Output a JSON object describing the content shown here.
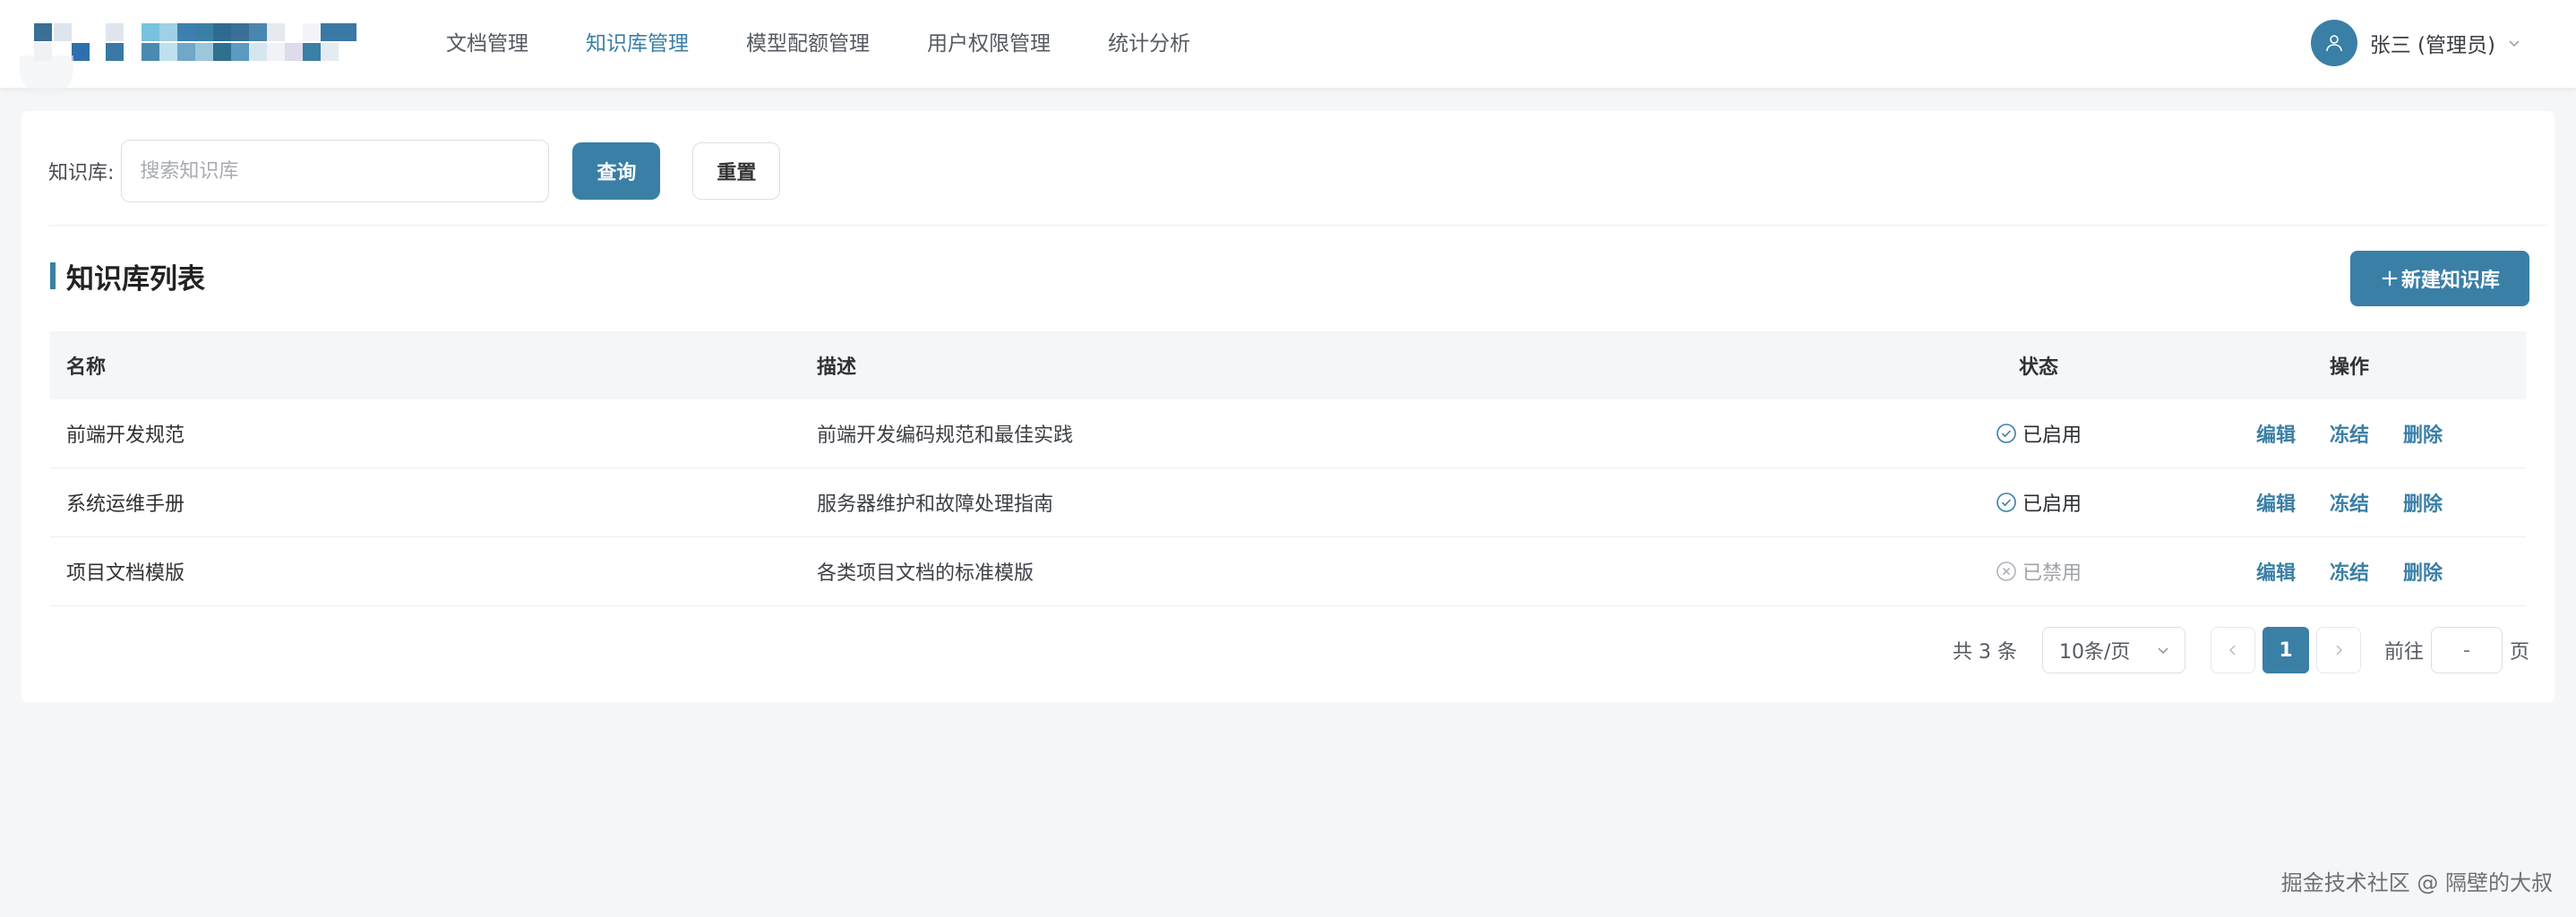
{
  "colors": {
    "accent": "#3a7fa6",
    "enabled_icon": "#3a7fa6",
    "disabled_icon": "#b0b3b8"
  },
  "nav": {
    "items": [
      {
        "label": "文档管理",
        "active": false
      },
      {
        "label": "知识库管理",
        "active": true
      },
      {
        "label": "模型配额管理",
        "active": false
      },
      {
        "label": "用户权限管理",
        "active": false
      },
      {
        "label": "统计分析",
        "active": false
      }
    ]
  },
  "user": {
    "name": "张三 (管理员)",
    "avatar_icon": "user-icon",
    "caret_icon": "chevron-down-icon"
  },
  "search": {
    "label": "知识库:",
    "placeholder": "搜索知识库",
    "value": "",
    "query_label": "查询",
    "reset_label": "重置"
  },
  "section": {
    "title": "知识库列表",
    "new_button_plus": "+",
    "new_button_label": "新建知识库"
  },
  "table": {
    "headers": {
      "name": "名称",
      "desc": "描述",
      "status": "状态",
      "ops": "操作"
    },
    "rows": [
      {
        "name": "前端开发规范",
        "desc": "前端开发编码规范和最佳实践",
        "status": "已启用",
        "enabled": true,
        "ops": [
          "编辑",
          "冻结",
          "删除"
        ]
      },
      {
        "name": "系统运维手册",
        "desc": "服务器维护和故障处理指南",
        "status": "已启用",
        "enabled": true,
        "ops": [
          "编辑",
          "冻结",
          "删除"
        ]
      },
      {
        "name": "项目文档模版",
        "desc": "各类项目文档的标准模版",
        "status": "已禁用",
        "enabled": false,
        "ops": [
          "编辑",
          "冻结",
          "删除"
        ]
      }
    ]
  },
  "pagination": {
    "total": "共 3 条",
    "page_size": "10条/页",
    "current_page": "1",
    "goto_label": "前往",
    "goto_value": "-",
    "page_unit": "页"
  },
  "watermark": "掘金技术社区 @ 隔壁的大叔"
}
